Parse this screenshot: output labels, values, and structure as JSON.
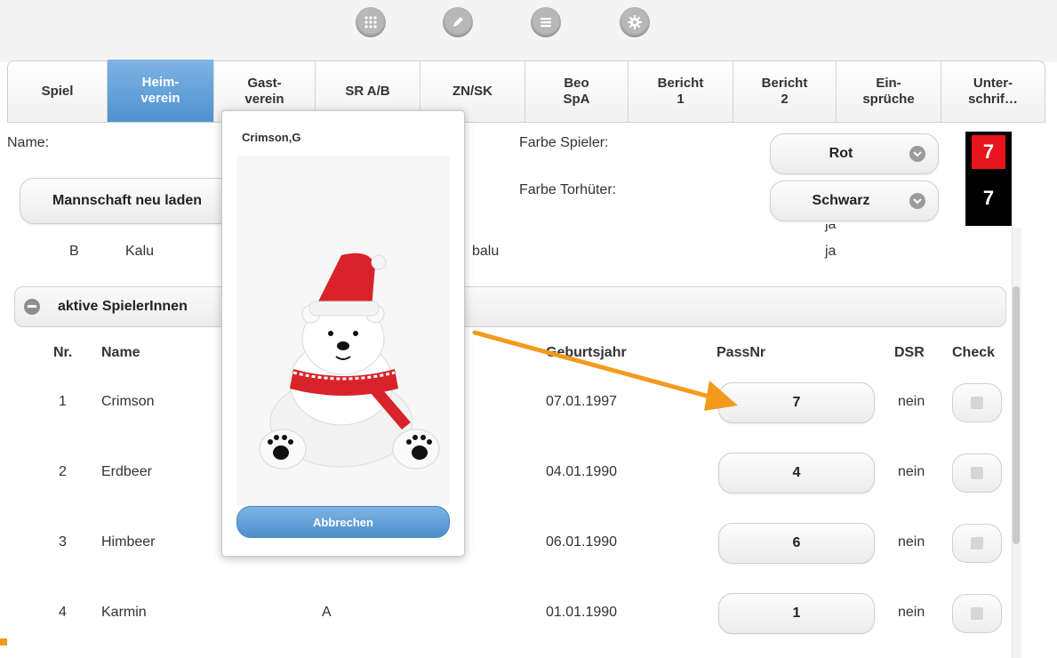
{
  "toolbar": {
    "icons": [
      "grid-icon",
      "pencil-icon",
      "list-icon",
      "gear-icon"
    ]
  },
  "tabs": [
    {
      "label": "Spiel",
      "active": false
    },
    {
      "label": "Heim-\nverein",
      "active": true
    },
    {
      "label": "Gast-\nverein",
      "active": false
    },
    {
      "label": "SR A/B",
      "active": false
    },
    {
      "label": "ZN/SK",
      "active": false
    },
    {
      "label": "Beo\nSpA",
      "active": false
    },
    {
      "label": "Bericht\n1",
      "active": false
    },
    {
      "label": "Bericht\n2",
      "active": false
    },
    {
      "label": "Ein-\nsprüche",
      "active": false
    },
    {
      "label": "Unter-\nschrif…",
      "active": false
    }
  ],
  "team": {
    "name_label": "Name:",
    "reload_button": "Mannschaft neu laden",
    "player_color_label": "Farbe Spieler:",
    "player_color_value": "Rot",
    "keeper_color_label": "Farbe Torhüter:",
    "keeper_color_value": "Schwarz",
    "player_number": "7",
    "keeper_number": "7",
    "player_box_color": "#e8141b",
    "keeper_box_color": "#000000"
  },
  "officials": [
    {
      "letter": "B",
      "name": "Kalu",
      "extra": "balu",
      "flag": "ja"
    }
  ],
  "partial_row": {
    "flag": "ja"
  },
  "players_section": {
    "title": "aktive SpielerInnen",
    "headers": {
      "nr": "Nr.",
      "name": "Name",
      "birth": "Geburtsjahr",
      "pass": "PassNr",
      "dsr": "DSR",
      "check": "Check"
    },
    "rows": [
      {
        "nr": "1",
        "name": "Crimson",
        "mid": "",
        "birth": "07.01.1997",
        "pass": "7",
        "dsr": "nein"
      },
      {
        "nr": "2",
        "name": "Erdbeer",
        "mid": "",
        "birth": "04.01.1990",
        "pass": "4",
        "dsr": "nein"
      },
      {
        "nr": "3",
        "name": "Himbeer",
        "mid": "",
        "birth": "06.01.1990",
        "pass": "6",
        "dsr": "nein"
      },
      {
        "nr": "4",
        "name": "Karmin",
        "mid": "A",
        "birth": "01.01.1990",
        "pass": "1",
        "dsr": "nein"
      }
    ]
  },
  "popup": {
    "title": "Crimson,G",
    "image": "polar-bear-with-santa-hat-and-scarf",
    "cancel_button": "Abbrechen"
  },
  "accent_color": "#5b9bd5",
  "annotation_arrow_color": "#f39a1e"
}
